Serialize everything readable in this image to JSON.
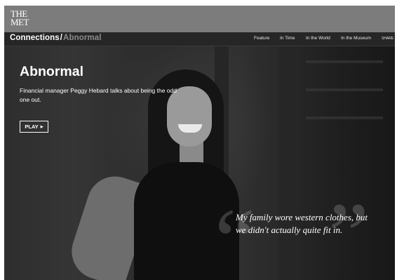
{
  "header": {
    "logo_line1": "THE",
    "logo_line2": "MET"
  },
  "nav": {
    "brand": "Connections",
    "separator": "/",
    "current": "Abnormal",
    "links": [
      "Feature",
      "In Time",
      "In the World",
      "In the Museum"
    ],
    "share": "SHARE"
  },
  "hero": {
    "title": "Abnormal",
    "description": "Financial manager Peggy Hebard talks about being the odd one out.",
    "play_label": "PLAY",
    "play_icon": "play-triangle-icon",
    "quote_open": "“",
    "quote_close": "”",
    "quote": "My family wore western clothes, but we didn't actually quite fit in."
  },
  "colors": {
    "topbar": "#7c7c7c",
    "navbar": "#262626",
    "accent_sub": "#8c8c8c"
  }
}
